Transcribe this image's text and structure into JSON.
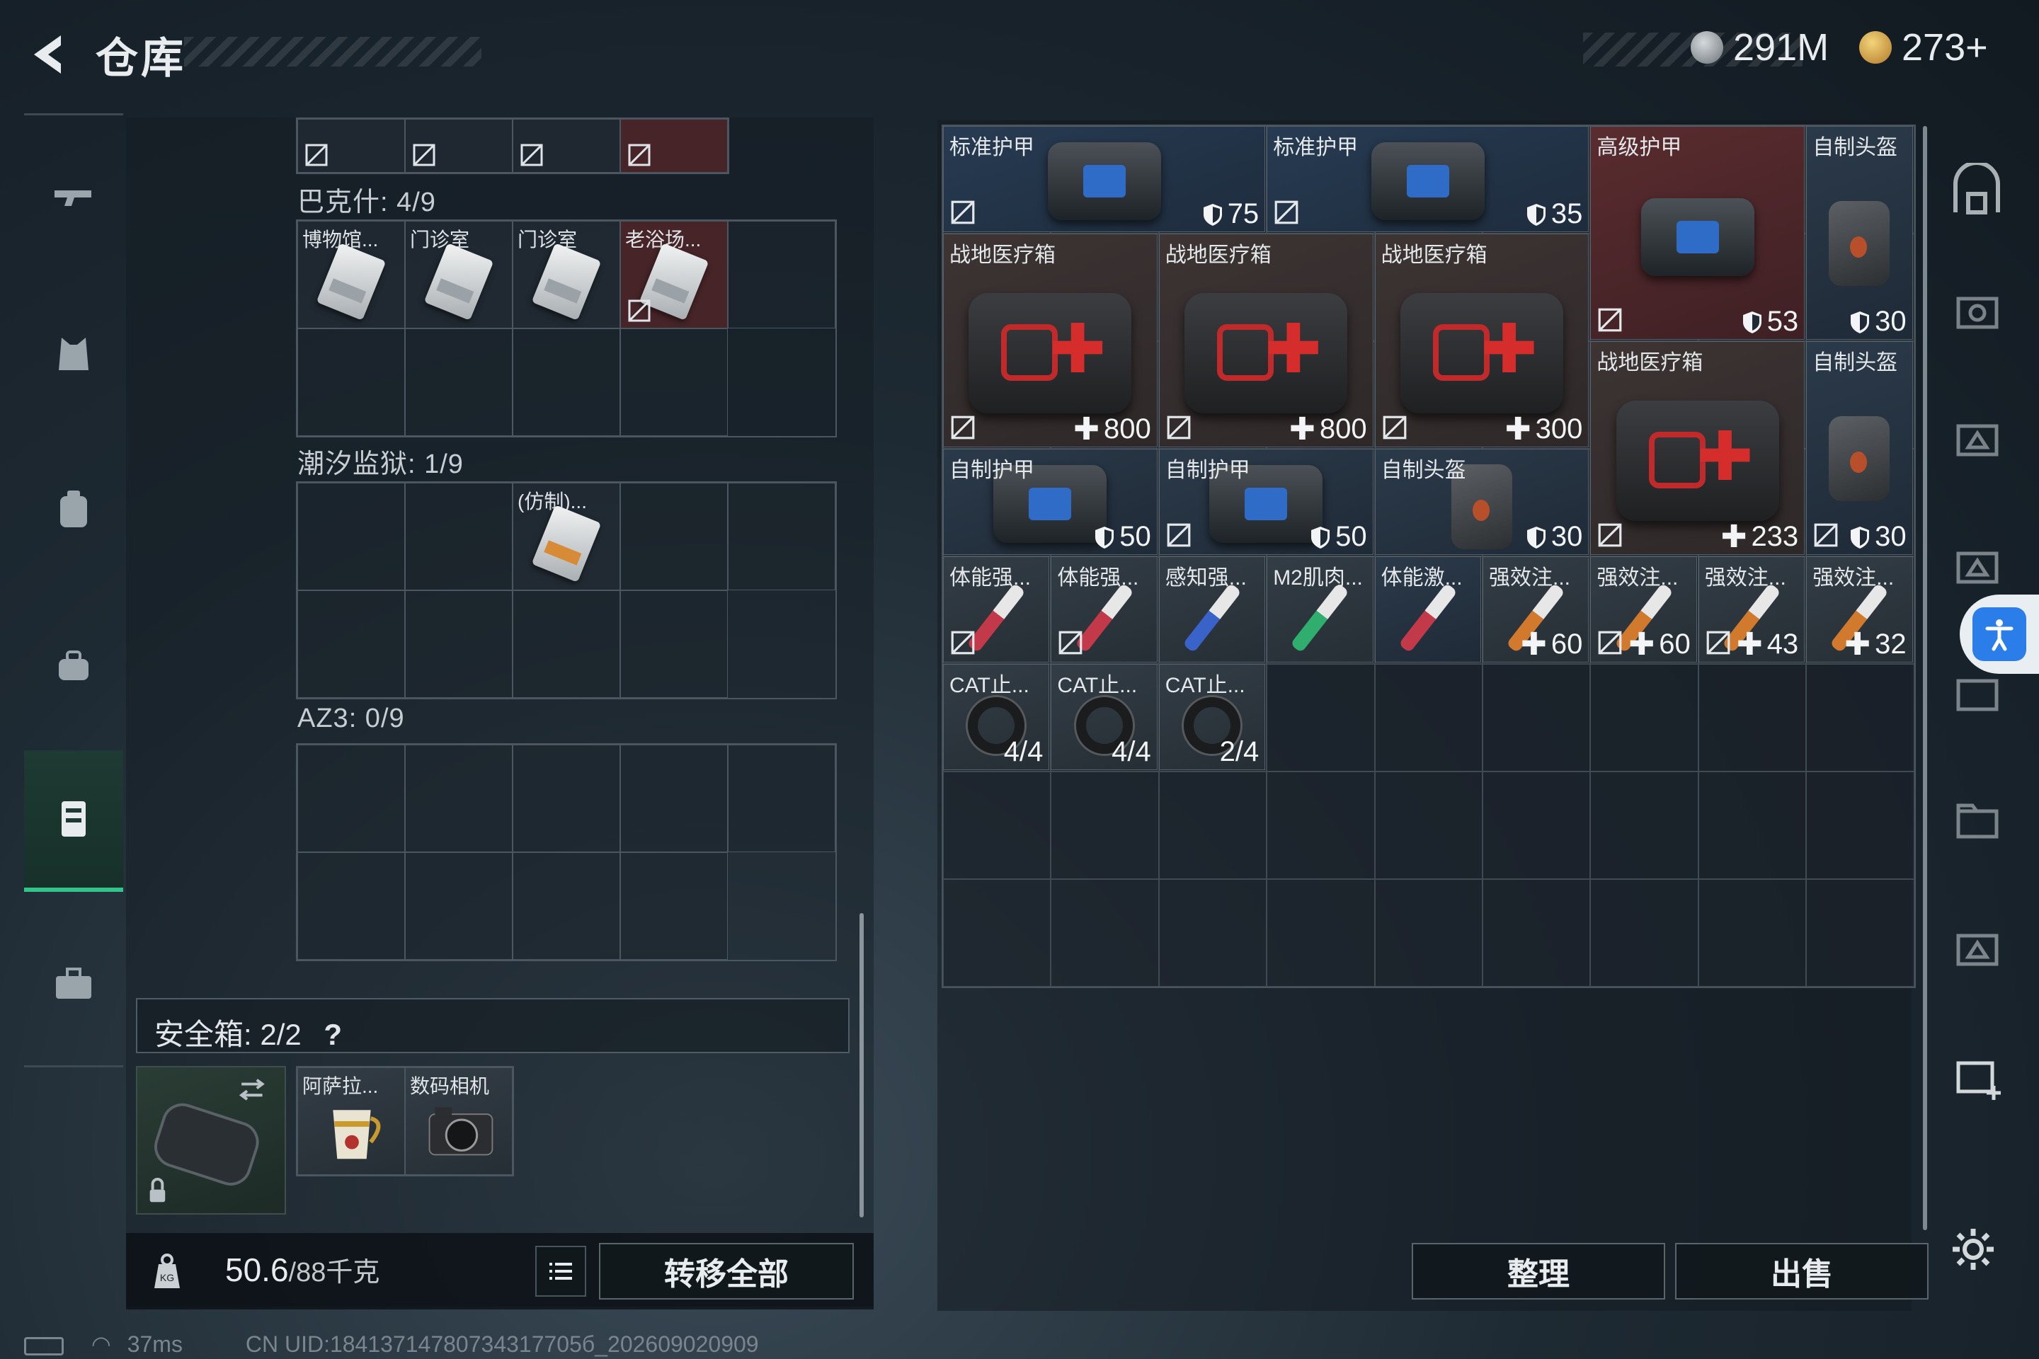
{
  "header": {
    "title": "仓库",
    "currency1": "291M",
    "currency2": "273+"
  },
  "left": {
    "sections": [
      {
        "label": "巴克什: 4/9",
        "items": [
          "博物馆...",
          "门诊室",
          "门诊室",
          "老浴场..."
        ]
      },
      {
        "label": "潮汐监狱: 1/9",
        "items": [
          "(仿制)..."
        ]
      },
      {
        "label": "AZ3: 0/9"
      }
    ],
    "safebox": {
      "label": "安全箱: 2/2",
      "help": "?",
      "items": [
        "阿萨拉...",
        "数码相机"
      ]
    },
    "weight": {
      "value": "50.6",
      "max": "/88千克"
    },
    "transfer_all": "转移全部"
  },
  "right": {
    "items": [
      {
        "name": "标准护甲",
        "value": "75",
        "kind": "armor"
      },
      {
        "name": "标准护甲",
        "value": "35",
        "kind": "armor"
      },
      {
        "name": "高级护甲",
        "value": "53",
        "kind": "armor"
      },
      {
        "name": "自制头盔",
        "value": "30",
        "kind": "armor"
      },
      {
        "name": "战地医疗箱",
        "value": "800",
        "kind": "heal"
      },
      {
        "name": "战地医疗箱",
        "value": "800",
        "kind": "heal"
      },
      {
        "name": "战地医疗箱",
        "value": "300",
        "kind": "heal"
      },
      {
        "name": "战地医疗箱",
        "value": "233",
        "kind": "heal"
      },
      {
        "name": "自制头盔",
        "value": "30",
        "kind": "armor"
      },
      {
        "name": "自制护甲",
        "value": "50",
        "kind": "armor"
      },
      {
        "name": "自制护甲",
        "value": "50",
        "kind": "armor"
      },
      {
        "name": "自制头盔",
        "value": "30",
        "kind": "armor"
      },
      {
        "name": "体能强...",
        "value": "",
        "kind": ""
      },
      {
        "name": "体能强...",
        "value": "",
        "kind": ""
      },
      {
        "name": "感知强...",
        "value": "",
        "kind": ""
      },
      {
        "name": "M2肌肉...",
        "value": "",
        "kind": ""
      },
      {
        "name": "体能激...",
        "value": "",
        "kind": ""
      },
      {
        "name": "强效注...",
        "value": "60",
        "kind": "heal"
      },
      {
        "name": "强效注...",
        "value": "60",
        "kind": "heal"
      },
      {
        "name": "强效注...",
        "value": "43",
        "kind": "heal"
      },
      {
        "name": "强效注...",
        "value": "32",
        "kind": "heal"
      },
      {
        "name": "CAT止...",
        "value": "4/4",
        "kind": "count"
      },
      {
        "name": "CAT止...",
        "value": "4/4",
        "kind": "count"
      },
      {
        "name": "CAT止...",
        "value": "2/4",
        "kind": "count"
      }
    ],
    "sort_button": "整理",
    "sell_button": "出售"
  },
  "status": {
    "ping": "37ms",
    "uid": "CN UID:18413714780734317705б_202609020909"
  },
  "colors": {
    "accent": "#33c489",
    "access": "#2b7de9"
  }
}
